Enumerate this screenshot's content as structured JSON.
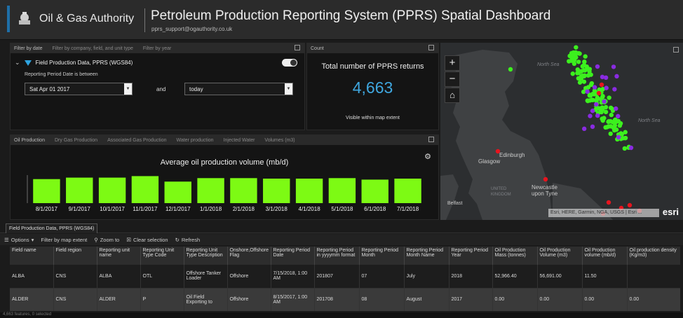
{
  "header": {
    "org_name": "Oil & Gas Authority",
    "title": "Petroleum Production Reporting System (PPRS) Spatial Dashboard",
    "email": "pprs_support@ogauthority.co.uk"
  },
  "filter_panel": {
    "tabs": [
      "Filter by date",
      "Filter by company, field, and unit type",
      "Filter by year"
    ],
    "layer_name": "Field Production Data, PPRS (WGS84)",
    "between_label": "Reporting Period Date is between",
    "from_value": "Sat Apr 01 2017",
    "and_label": "and",
    "to_value": "today"
  },
  "count_panel": {
    "tab": "Count",
    "title": "Total number of PPRS returns",
    "value": "4,663",
    "subtitle": "Visible within map extent"
  },
  "chart_panel": {
    "tabs": [
      "Oil Production",
      "Dry Gas Production",
      "Associated Gas Production",
      "Water production",
      "Injected Water",
      "Volumes (m3)"
    ]
  },
  "chart_data": {
    "type": "bar",
    "title": "Average oil production volume (mb/d)",
    "categories": [
      "8/1/2017",
      "9/1/2017",
      "10/1/2017",
      "11/1/2017",
      "12/1/2017",
      "1/1/2018",
      "2/1/2018",
      "3/1/2018",
      "4/1/2018",
      "5/1/2018",
      "6/1/2018",
      "7/1/2018"
    ],
    "values": [
      4.8,
      5.1,
      5.1,
      5.4,
      4.3,
      5.0,
      5.0,
      4.9,
      4.9,
      5.0,
      4.7,
      4.9
    ],
    "color": "#7dfa14",
    "ylim": [
      0,
      5.6
    ]
  },
  "map": {
    "labels": [
      "North Sea",
      "North Sea",
      "Edinburgh",
      "Glasgow",
      "Newcastle upon Tyne",
      "UNITED KINGDOM",
      "Belfast"
    ],
    "attribution": "Esri, HERE, Garmin, NGA, USGS | Esri ...",
    "logo": "esri",
    "zoom_in": "+",
    "zoom_out": "−",
    "home": "⌂",
    "colors": {
      "green": "#3cf01e",
      "purple": "#8a2be2",
      "red": "#e8141e"
    }
  },
  "table": {
    "tab": "Field Production Data, PPRS (WGS84)",
    "toolbar": [
      "Options",
      "Filter by map extent",
      "Zoom to",
      "Clear selection",
      "Refresh"
    ],
    "columns": [
      "Field name",
      "Field region",
      "Reporting unit name",
      "Reporting Unit Type Code",
      "Reporting Unit Type Description",
      "Onshore,Offshore Flag",
      "Reporting Period Date",
      "Reporting Period in yyyymm format",
      "Reporting Period Month",
      "Reporting Period Month Name",
      "Reporting Period Year",
      "Oil Production Mass (tonnes)",
      "Oil Production Volume (m3)",
      "Oil Production volume (mb/d)",
      "Oil production density (Kg/m3)"
    ],
    "rows": [
      [
        "ALBA",
        "CNS",
        "ALBA",
        "OTL",
        "Offshore Tanker Loader",
        "Offshore",
        "7/15/2018, 1:00 AM",
        "201807",
        "07",
        "July",
        "2018",
        "52,966.40",
        "56,691.00",
        "11.50",
        ""
      ],
      [
        "ALDER",
        "CNS",
        "ALDER",
        "P",
        "Oil Field Exporting to",
        "Offshore",
        "8/15/2017, 1:00 AM",
        "201708",
        "08",
        "August",
        "2017",
        "0.00",
        "0.00",
        "0.00",
        "0.00"
      ]
    ],
    "status": "4,663 features, 0 selected"
  }
}
